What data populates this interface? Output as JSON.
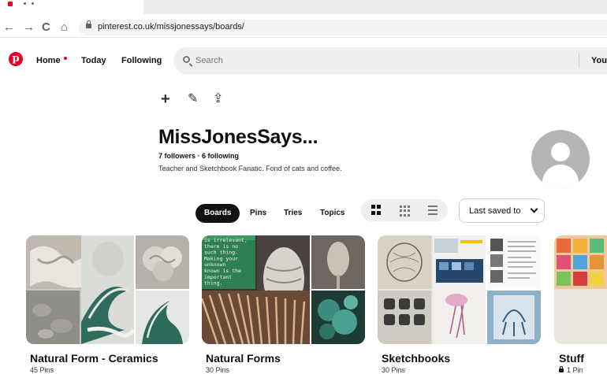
{
  "browser": {
    "url": "pinterest.co.uk/missjonessays/boards/",
    "nav": {
      "back": "←",
      "forward": "→",
      "reload": "C",
      "home": "⌂"
    }
  },
  "header": {
    "logo": "p",
    "nav_items": [
      "Home",
      "Today",
      "Following"
    ],
    "search_placeholder": "Search",
    "account_label": "Your"
  },
  "profile": {
    "name": "MissJonesSays...",
    "stats": "7 followers · 6 following",
    "bio": "Teacher and Sketchbook Fanatic. Fond of cats and coffee."
  },
  "actions": {
    "add": "+",
    "edit": "✎",
    "share": "⇪"
  },
  "tabs": [
    "Boards",
    "Pins",
    "Tries",
    "Topics"
  ],
  "active_tab": "Boards",
  "sort": {
    "label": "Last saved to"
  },
  "boards": [
    {
      "title": "Natural Form - Ceramics",
      "count": "45 Pins",
      "secret": false
    },
    {
      "title": "Natural Forms",
      "count": "30 Pins",
      "secret": false
    },
    {
      "title": "Sketchbooks",
      "count": "30 Pins",
      "secret": false
    },
    {
      "title": "Stuff",
      "count": "1 Pin",
      "secret": true
    }
  ],
  "board_cover_text": [
    "is irrelevant,",
    "there is no",
    "such thing.",
    "Making your",
    "unknown",
    "known is the",
    "important",
    "thing."
  ],
  "colors": {
    "brand": "#e60023",
    "active_tab_bg": "#111111"
  }
}
